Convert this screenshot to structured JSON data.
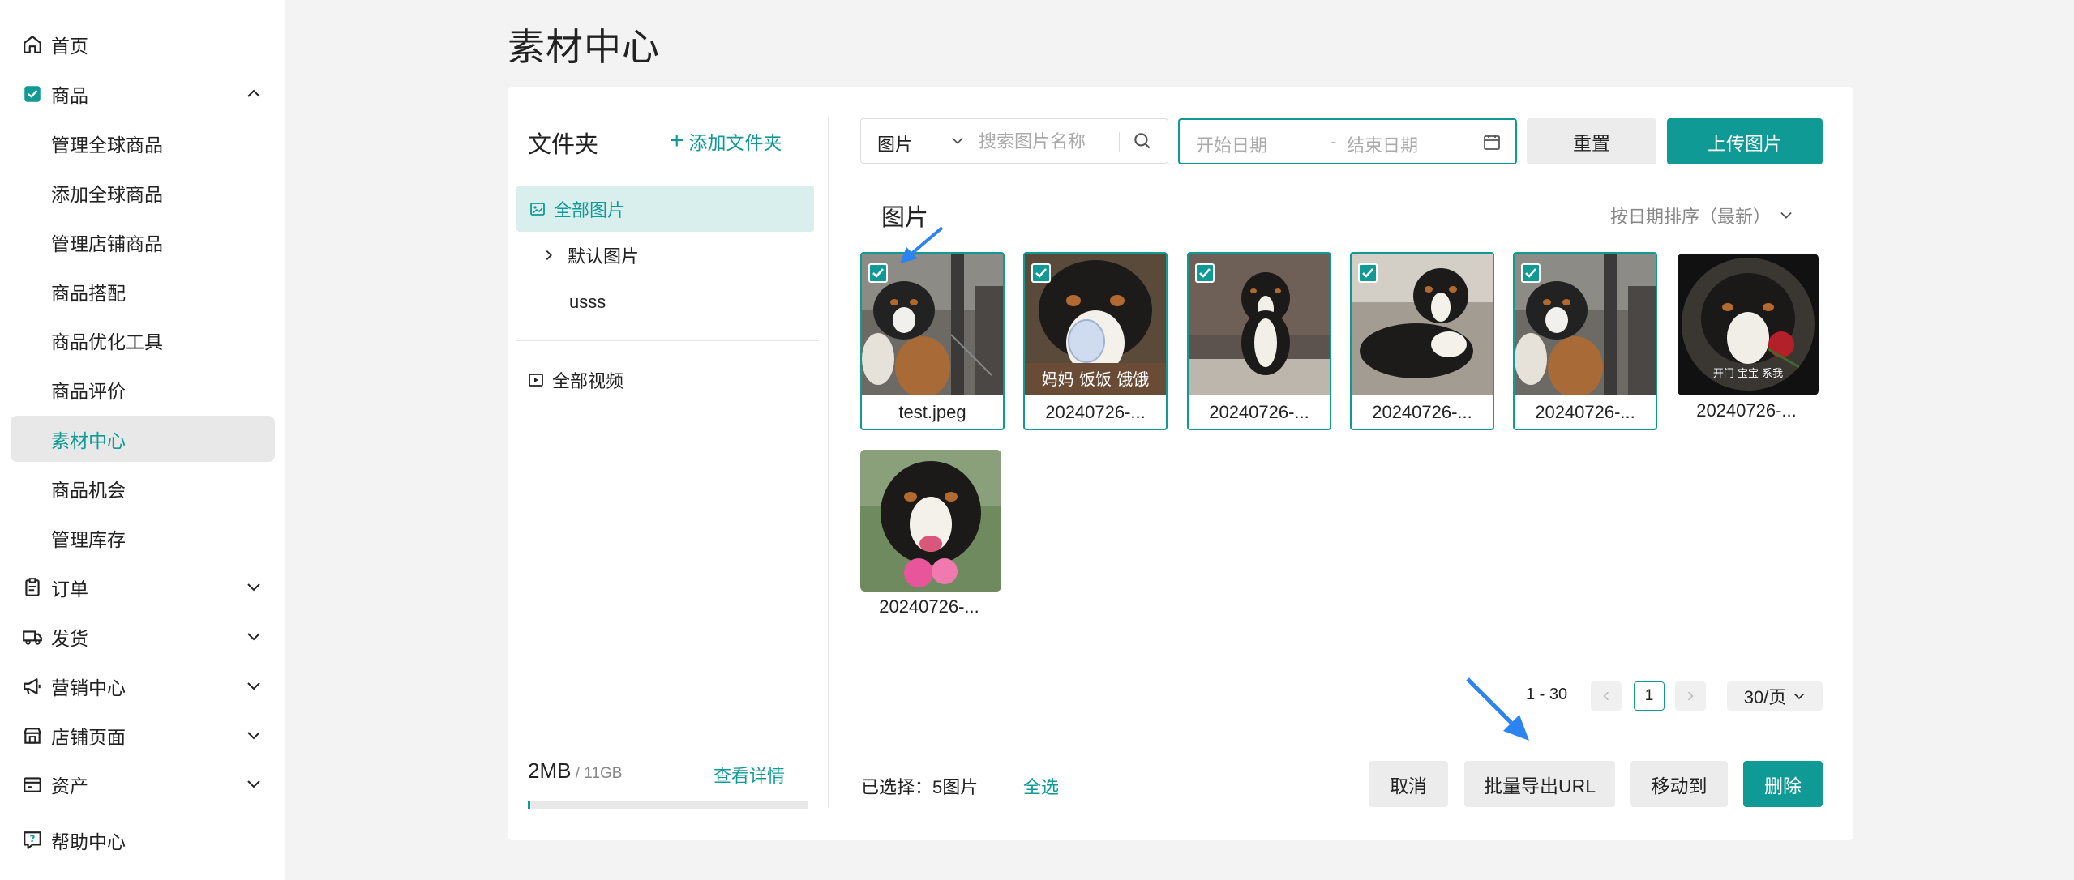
{
  "sidebar": {
    "items": [
      {
        "label": "首页",
        "icon": "home-icon"
      },
      {
        "label": "商品",
        "icon": "product-icon",
        "expanded": true
      },
      {
        "label": "管理全球商品"
      },
      {
        "label": "添加全球商品"
      },
      {
        "label": "管理店铺商品"
      },
      {
        "label": "商品搭配"
      },
      {
        "label": "商品优化工具"
      },
      {
        "label": "商品评价"
      },
      {
        "label": "素材中心",
        "active": true
      },
      {
        "label": "商品机会"
      },
      {
        "label": "管理库存"
      },
      {
        "label": "订单",
        "icon": "order-icon"
      },
      {
        "label": "发货",
        "icon": "truck-icon"
      },
      {
        "label": "营销中心",
        "icon": "megaphone-icon"
      },
      {
        "label": "店铺页面",
        "icon": "store-icon"
      },
      {
        "label": "资产",
        "icon": "wallet-icon"
      },
      {
        "label": "帮助中心",
        "icon": "help-icon"
      }
    ]
  },
  "page": {
    "title": "素材中心"
  },
  "folders": {
    "title": "文件夹",
    "add_label": "添加文件夹",
    "all_images": "全部图片",
    "default_images": "默认图片",
    "usss": "usss",
    "all_videos": "全部视频",
    "storage_used": "2MB",
    "storage_total": " / 11GB",
    "storage_detail": "查看详情",
    "storage_fraction": 0.01
  },
  "filter": {
    "type": "图片",
    "search_placeholder": "搜索图片名称",
    "date_start": "开始日期",
    "date_dash": "-",
    "date_end": "结束日期",
    "reset_label": "重置",
    "upload_label": "上传图片"
  },
  "gallery": {
    "title": "图片",
    "sort_label": "按日期排序（最新）",
    "images": [
      {
        "name": "test.jpeg",
        "selected": true
      },
      {
        "name": "20240726-...",
        "selected": true,
        "caption": "妈妈 饭饭 饿饿"
      },
      {
        "name": "20240726-...",
        "selected": true
      },
      {
        "name": "20240726-...",
        "selected": true
      },
      {
        "name": "20240726-...",
        "selected": true
      },
      {
        "name": "20240726-...",
        "selected": false,
        "caption": "开门 宝宝 系我"
      },
      {
        "name": "20240726-...",
        "selected": false
      }
    ]
  },
  "pagination": {
    "range": "1 - 30",
    "current": "1",
    "page_size": "30/页"
  },
  "footer": {
    "selected_text": "已选择：5图片",
    "select_all": "全选",
    "cancel": "取消",
    "export_url": "批量导出URL",
    "move_to": "移动到",
    "delete": "删除"
  },
  "colors": {
    "accent": "#0f9a95",
    "annotation_arrow": "#2b84f0"
  }
}
